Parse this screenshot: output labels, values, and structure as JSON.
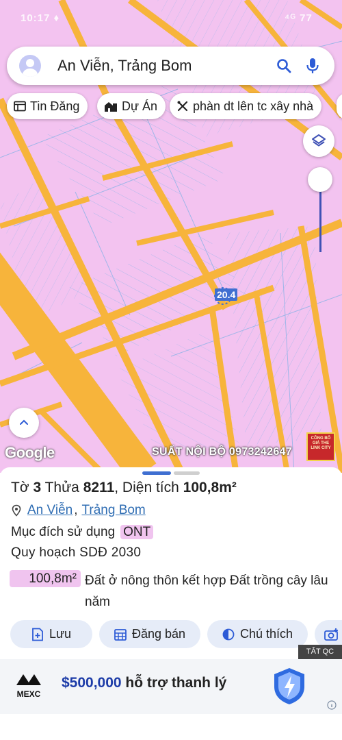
{
  "status_bar": {
    "time": "10:17 ♦",
    "signals": "⁴ᴳ 77"
  },
  "search": {
    "query": "An Viễn, Trảng Bom"
  },
  "chips": [
    {
      "label": "Tin Đăng",
      "icon": "news-icon"
    },
    {
      "label": "Dự Án",
      "icon": "building-icon"
    },
    {
      "label": "phàn dt lên tc xây nhà",
      "icon": "tools-icon"
    }
  ],
  "map": {
    "parcel_label": "20.4",
    "google_label": "Google",
    "watermark": "SUẤT NỘI BỘ 0973242647",
    "stamp_text": "CÔNG BỐ GIÁ THE LINK CITY"
  },
  "info": {
    "title_prefix": "Tờ",
    "sheet_no": "3",
    "parcel_word": "Thửa",
    "parcel_no": "8211",
    "area_word": ", Diện tích",
    "area": "100,8m²",
    "commune": "An Viễn",
    "comma": ",",
    "district": "Trảng Bom",
    "purpose_label": "Mục đích sử dụng",
    "purpose_code": "ONT",
    "plan_label": "Quy hoạch SDĐ 2030",
    "plan_area": "100,8m²",
    "plan_desc": "Đất ở nông thôn kết hợp Đất trồng cây lâu năm"
  },
  "actions": [
    {
      "label": "Lưu",
      "icon": "save-icon"
    },
    {
      "label": "Đăng bán",
      "icon": "calendar-icon"
    },
    {
      "label": "Chú thích",
      "icon": "contrast-icon"
    },
    {
      "label": "",
      "icon": "camera-plus-icon"
    }
  ],
  "ad": {
    "close_label": "TẮT QC",
    "brand": "MEXC",
    "amount": "$500,000",
    "text": " hỗ trợ thanh lý"
  },
  "colors": {
    "land": "#f3c3f0",
    "road": "#f7b43b",
    "line": "#9fb6e8",
    "accent": "#3f51b5"
  }
}
